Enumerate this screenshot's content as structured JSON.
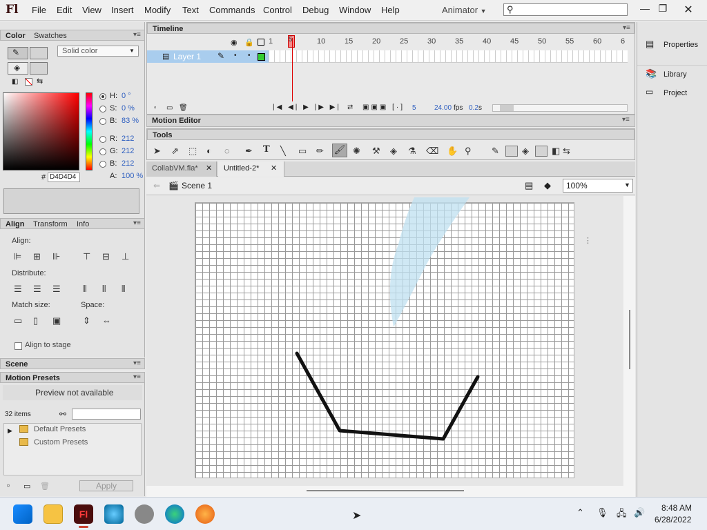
{
  "app": {
    "logo": "Fl",
    "workspace": "Animator",
    "search_placeholder": ""
  },
  "menu": [
    "File",
    "Edit",
    "View",
    "Insert",
    "Modify",
    "Text",
    "Commands",
    "Control",
    "Debug",
    "Window",
    "Help"
  ],
  "color_panel": {
    "tabs": [
      "Color",
      "Swatches"
    ],
    "fill_type": "Solid color",
    "hsb": {
      "h_label": "H:",
      "h": "0 °",
      "s_label": "S:",
      "s": "0 %",
      "b_label": "B:",
      "b": "83 %"
    },
    "rgb": {
      "r_label": "R:",
      "r": "212",
      "g_label": "G:",
      "g": "212",
      "b_label": "B:",
      "b": "212",
      "a_label": "A:",
      "a": "100 %"
    },
    "hex_label": "#",
    "hex": "D4D4D4"
  },
  "align_panel": {
    "tabs": [
      "Align",
      "Transform",
      "Info"
    ],
    "align_label": "Align:",
    "distribute_label": "Distribute:",
    "match_size_label": "Match size:",
    "space_label": "Space:",
    "align_to_stage": "Align to stage"
  },
  "scene_panel": {
    "title": "Scene"
  },
  "motion_presets": {
    "title": "Motion Presets",
    "preview": "Preview not available",
    "count": "32 items",
    "folders": [
      "Default Presets",
      "Custom Presets"
    ],
    "apply": "Apply"
  },
  "timeline": {
    "title": "Timeline",
    "layer_name": "Layer 1",
    "frame_numbers": [
      "1",
      "5",
      "10",
      "15",
      "20",
      "25",
      "30",
      "35",
      "40",
      "45",
      "50",
      "55",
      "60",
      "6"
    ],
    "current_frame": "5",
    "fps": "24.00",
    "fps_unit": "fps",
    "time": "0.2",
    "time_unit": "s"
  },
  "motion_editor": {
    "title": "Motion Editor"
  },
  "tools_panel": {
    "title": "Tools"
  },
  "doc_tabs": [
    {
      "label": "CollabVM.fla*"
    },
    {
      "label": "Untitled-2*"
    }
  ],
  "scene_bar": {
    "scene": "Scene 1",
    "zoom": "100%"
  },
  "right_panel": {
    "items": [
      "Properties",
      "Library",
      "Project"
    ]
  },
  "taskbar": {
    "time": "8:48 AM",
    "date": "6/28/2022"
  },
  "colors": {
    "accent": "#cde5f7",
    "stroke": "#000000",
    "fill": "#d4d4d4"
  }
}
